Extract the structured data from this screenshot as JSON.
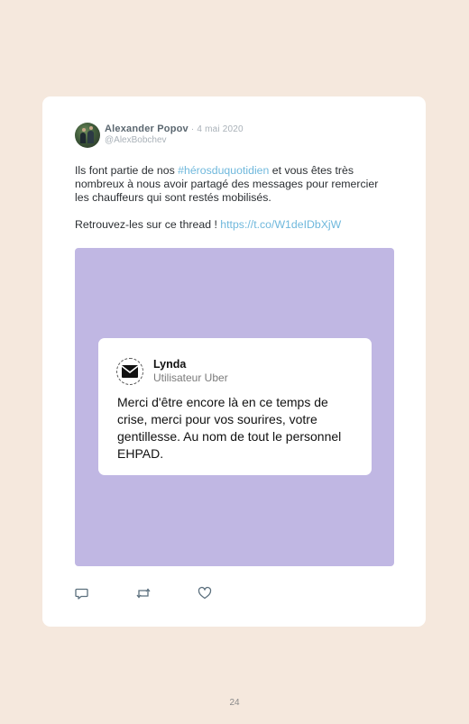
{
  "tweet": {
    "author_name": "Alexander Popov",
    "date": " · 4 mai 2020",
    "handle": "@AlexBobchev",
    "text_part1": "Ils font partie de nos ",
    "hashtag": "#hérosduquotidien",
    "text_part2": " et vous êtes très nombreux à nous avoir partagé des messages pour remercier les chauffeurs qui sont restés mobilisés.",
    "text_part3": "Retrouvez-les sur ce thread ! ",
    "link": "https://t.co/W1deIDbXjW"
  },
  "message_card": {
    "name": "Lynda",
    "role": "Utilisateur Uber",
    "body": "Merci d'être encore là en ce temps de crise, merci pour vos sourires, votre gentillesse. Au nom de tout le personnel EHPAD.",
    "icon": "envelope-icon"
  },
  "actions": {
    "icons": [
      "reply-icon",
      "retweet-icon",
      "like-icon"
    ]
  },
  "colors": {
    "page_background": "#f5e8dd",
    "media_background": "#c0b7e3",
    "link": "#6fb8dc"
  },
  "page_number": "24"
}
